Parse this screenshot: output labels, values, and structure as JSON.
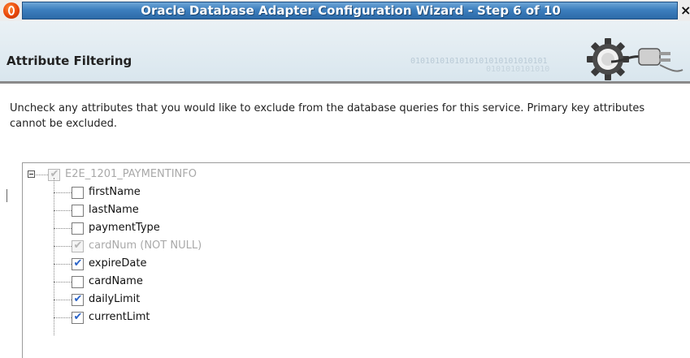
{
  "window": {
    "title": "Oracle Database Adapter Configuration Wizard - Step 6 of 10",
    "close_glyph": "×",
    "icon": "oracle-app-icon"
  },
  "header": {
    "title": "Attribute Filtering",
    "binary_decor_1": "0101010101010101010101010101",
    "binary_decor_2": "0101010101010",
    "graphic_icon": "gear-plug-icon"
  },
  "instructions": "Uncheck any attributes that you would like to exclude from the database queries for this service.  Primary key attributes cannot be excluded.",
  "tree": {
    "root": {
      "label": "E2E_1201_PAYMENTINFO",
      "checked": true,
      "enabled": false,
      "expanded": true
    },
    "items": [
      {
        "label": "firstName",
        "checked": false,
        "enabled": true
      },
      {
        "label": "lastName",
        "checked": false,
        "enabled": true
      },
      {
        "label": "paymentType",
        "checked": false,
        "enabled": true
      },
      {
        "label": "cardNum (NOT NULL)",
        "checked": true,
        "enabled": false
      },
      {
        "label": "expireDate",
        "checked": true,
        "enabled": true
      },
      {
        "label": "cardName",
        "checked": false,
        "enabled": true
      },
      {
        "label": "dailyLimit",
        "checked": true,
        "enabled": true
      },
      {
        "label": "currentLimt",
        "checked": true,
        "enabled": true
      }
    ]
  },
  "colors": {
    "title_band": "#3d7fbe",
    "check_enabled": "#2a63c8",
    "check_disabled": "#b5b5b5",
    "app_icon": "#e8460a"
  }
}
